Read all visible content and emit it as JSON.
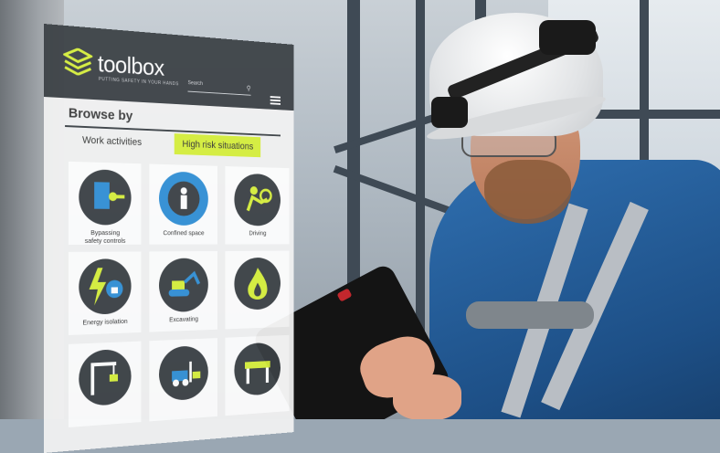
{
  "brand": {
    "name": "toolbox",
    "tagline": "PUTTING SAFETY IN YOUR HANDS",
    "accent_color": "#d7f03a",
    "header_color": "#3a3f44"
  },
  "search": {
    "placeholder": "Search"
  },
  "browse": {
    "title": "Browse by",
    "tabs": [
      {
        "label": "Work activities"
      },
      {
        "label": "High risk situations"
      }
    ]
  },
  "tiles": [
    {
      "label_line1": "Bypassing",
      "label_line2": "safety controls",
      "icon": "key-door-icon"
    },
    {
      "label_line1": "Confined space",
      "label_line2": "",
      "icon": "confined-space-icon"
    },
    {
      "label_line1": "Driving",
      "label_line2": "",
      "icon": "driving-icon"
    },
    {
      "label_line1": "Energy isolation",
      "label_line2": "",
      "icon": "energy-lock-icon"
    },
    {
      "label_line1": "Excavating",
      "label_line2": "",
      "icon": "excavator-icon"
    },
    {
      "label_line1": "",
      "label_line2": "",
      "icon": "fire-icon"
    },
    {
      "label_line1": "",
      "label_line2": "",
      "icon": "crane-lifting-icon"
    },
    {
      "label_line1": "",
      "label_line2": "",
      "icon": "forklift-icon"
    },
    {
      "label_line1": "",
      "label_line2": "",
      "icon": "barrier-icon"
    }
  ]
}
